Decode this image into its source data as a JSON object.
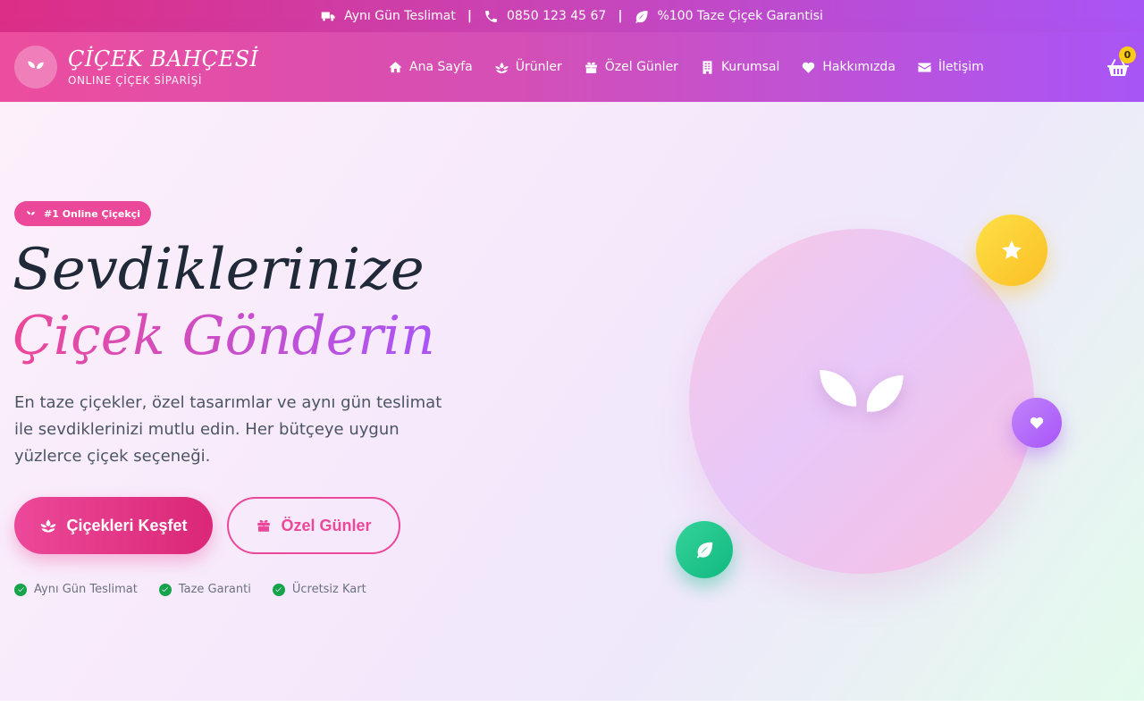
{
  "topbar": {
    "delivery": "Aynı Gün Teslimat",
    "phone": "0850 123 45 67",
    "guarantee": "%100 Taze Çiçek Garantisi",
    "separator": "|"
  },
  "brand": {
    "title": "ÇİÇEK BAHÇESİ",
    "subtitle": "ONLINE ÇİÇEK SİPARİŞİ"
  },
  "nav": {
    "items": [
      {
        "label": "Ana Sayfa",
        "icon": "home-icon"
      },
      {
        "label": "Ürünler",
        "icon": "lotus-icon"
      },
      {
        "label": "Özel Günler",
        "icon": "gift-icon"
      },
      {
        "label": "Kurumsal",
        "icon": "building-icon"
      },
      {
        "label": "Hakkımızda",
        "icon": "heart-icon"
      },
      {
        "label": "İletişim",
        "icon": "envelope-icon"
      }
    ]
  },
  "cart": {
    "count": "0"
  },
  "hero": {
    "badge": "#1 Online Çiçekçi",
    "title_line1": "Sevdiklerinize",
    "title_line2": "Çiçek Gönderin",
    "description": "En taze çiçekler, özel tasarımlar ve aynı gün teslimat ile sevdiklerinizi mutlu edin. Her bütçeye uygun yüzlerce çiçek seçeneği.",
    "primary_button": "Çiçekleri Keşfet",
    "secondary_button": "Özel Günler",
    "features": [
      "Aynı Gün Teslimat",
      "Taze Garanti",
      "Ücretsiz Kart"
    ]
  },
  "colors": {
    "accent_pink": "#ec4899",
    "accent_purple": "#a855f7",
    "check_green": "#16a34a",
    "star_yellow": "#fbbf24"
  }
}
